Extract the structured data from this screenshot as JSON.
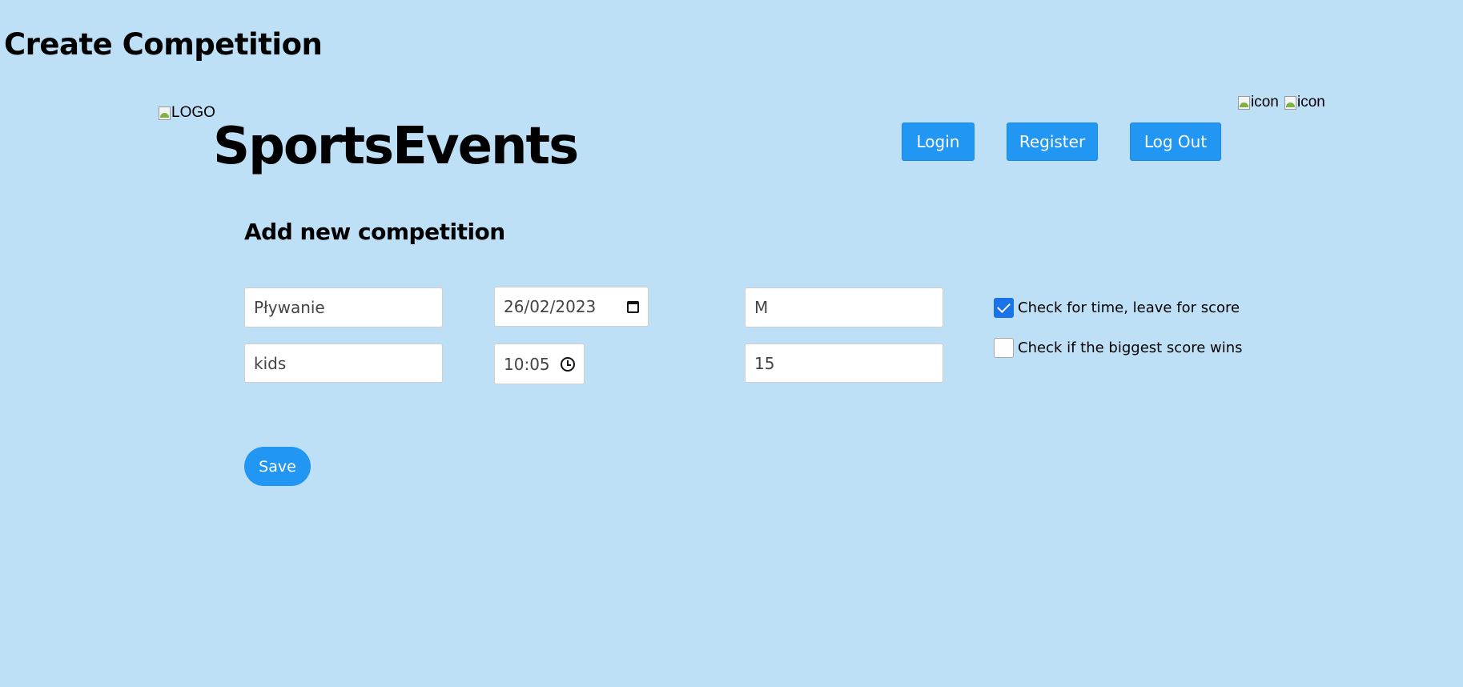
{
  "page": {
    "title": "Create Competition"
  },
  "header": {
    "logo_alt": "LOGO",
    "brand": "SportsEvents",
    "icons": [
      {
        "alt": "icon",
        "name": "broken-image-icon"
      },
      {
        "alt": "icon",
        "name": "broken-image-icon"
      }
    ],
    "nav": {
      "login": "Login",
      "register": "Register",
      "logout": "Log Out"
    }
  },
  "form": {
    "heading": "Add new competition",
    "discipline": "Pływanie",
    "category": "kids",
    "date": "26/02/2023",
    "time": "10:05",
    "gender": "M",
    "limit": "15",
    "checkboxes": [
      {
        "label": "Check for time, leave for score",
        "checked": true
      },
      {
        "label": "Check if the biggest score wins",
        "checked": false
      }
    ],
    "save": "Save"
  },
  "colors": {
    "background": "#bde0f7",
    "button": "#2196f3",
    "checkbox_accent": "#1a73e8"
  }
}
